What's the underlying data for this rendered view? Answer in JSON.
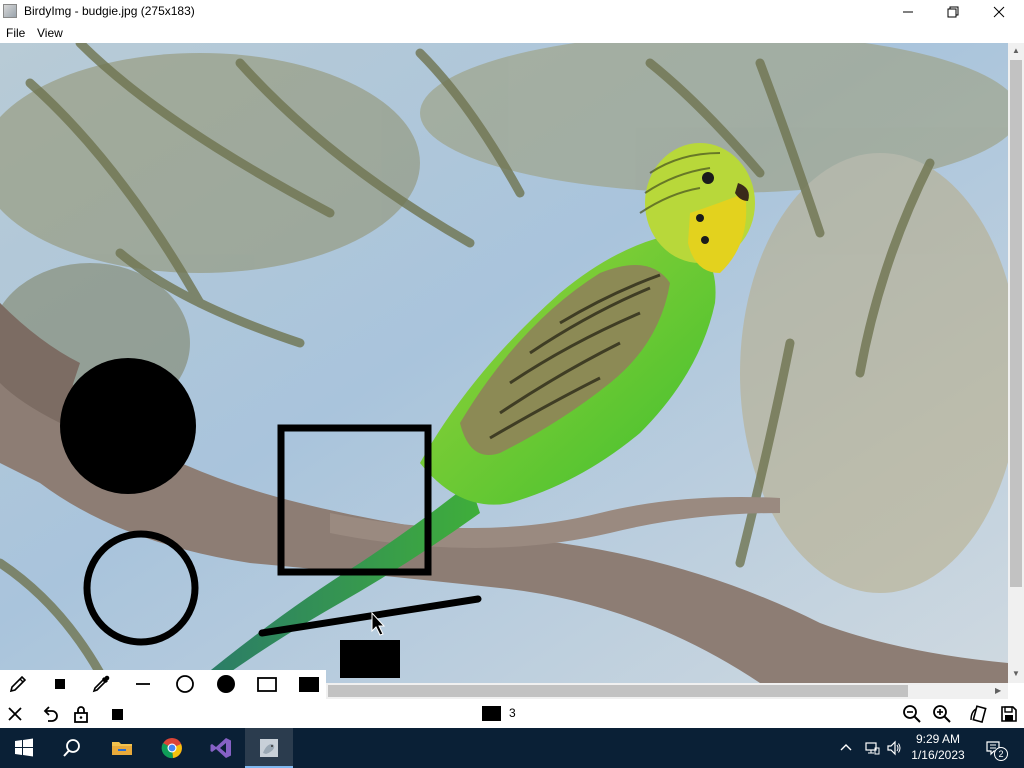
{
  "window": {
    "title": "BirdyImg - budgie.jpg (275x183)",
    "icon": "app-icon",
    "controls": [
      "minimize-icon",
      "maximize-icon",
      "close-icon"
    ]
  },
  "menu": [
    {
      "label": "File"
    },
    {
      "label": "View"
    }
  ],
  "image": {
    "file": "budgie.jpg",
    "description_icon": "photo-canvas"
  },
  "tools": [
    {
      "name": "pencil-icon"
    },
    {
      "name": "small-square-icon"
    },
    {
      "name": "eyedropper-icon"
    },
    {
      "name": "line-icon"
    },
    {
      "name": "circle-outline-icon"
    },
    {
      "name": "circle-filled-icon"
    },
    {
      "name": "rectangle-outline-icon"
    },
    {
      "name": "rectangle-filled-icon"
    }
  ],
  "status": {
    "brush_size": "3",
    "brush_color": "#000000",
    "left_buttons": [
      "close-icon",
      "undo-icon",
      "lock-icon",
      "stop-icon"
    ],
    "right_buttons": [
      "zoom-out-icon",
      "zoom-in-icon",
      "rotate-icon",
      "save-icon"
    ]
  },
  "taskbar": {
    "apps": [
      "windows-start-icon",
      "search-icon",
      "file-explorer-icon",
      "chrome-icon",
      "visual-studio-icon",
      "birdyimg-icon"
    ],
    "clock_time": "9:29 AM",
    "clock_date": "1/16/2023",
    "notification_count": "2"
  },
  "colors": {
    "taskbar": "#0a2036",
    "accent": "#7fb8f0",
    "scrollbar": "#c2c2c2"
  }
}
